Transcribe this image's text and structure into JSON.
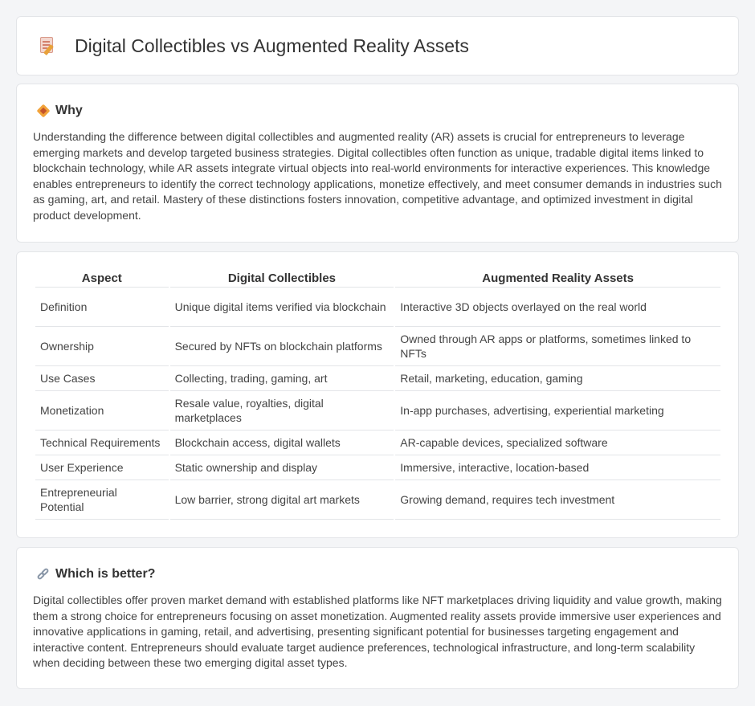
{
  "header": {
    "title": "Digital Collectibles vs Augmented Reality Assets",
    "icon": "document-pencil-icon"
  },
  "why": {
    "label": "Why",
    "icon": "diamond-icon",
    "text": "Understanding the difference between digital collectibles and augmented reality (AR) assets is crucial for entrepreneurs to leverage emerging markets and develop targeted business strategies. Digital collectibles often function as unique, tradable digital items linked to blockchain technology, while AR assets integrate virtual objects into real-world environments for interactive experiences. This knowledge enables entrepreneurs to identify the correct technology applications, monetize effectively, and meet consumer demands in industries such as gaming, art, and retail. Mastery of these distinctions fosters innovation, competitive advantage, and optimized investment in digital product development."
  },
  "table": {
    "headers": [
      "Aspect",
      "Digital Collectibles",
      "Augmented Reality Assets"
    ],
    "rows": [
      [
        "Definition",
        "Unique digital items verified via blockchain",
        "Interactive 3D objects overlayed on the real world"
      ],
      [
        "Ownership",
        "Secured by NFTs on blockchain platforms",
        "Owned through AR apps or platforms, sometimes linked to NFTs"
      ],
      [
        "Use Cases",
        "Collecting, trading, gaming, art",
        "Retail, marketing, education, gaming"
      ],
      [
        "Monetization",
        "Resale value, royalties, digital marketplaces",
        "In-app purchases, advertising, experiential marketing"
      ],
      [
        "Technical Requirements",
        "Blockchain access, digital wallets",
        "AR-capable devices, specialized software"
      ],
      [
        "User Experience",
        "Static ownership and display",
        "Immersive, interactive, location-based"
      ],
      [
        "Entrepreneurial Potential",
        "Low barrier, strong digital art markets",
        "Growing demand, requires tech investment"
      ]
    ]
  },
  "better": {
    "label": "Which is better?",
    "icon": "link-icon",
    "text": "Digital collectibles offer proven market demand with established platforms like NFT marketplaces driving liquidity and value growth, making them a strong choice for entrepreneurs focusing on asset monetization. Augmented reality assets provide immersive user experiences and innovative applications in gaming, retail, and advertising, presenting significant potential for businesses targeting engagement and interactive content. Entrepreneurs should evaluate target audience preferences, technological infrastructure, and long-term scalability when deciding between these two emerging digital asset types."
  }
}
